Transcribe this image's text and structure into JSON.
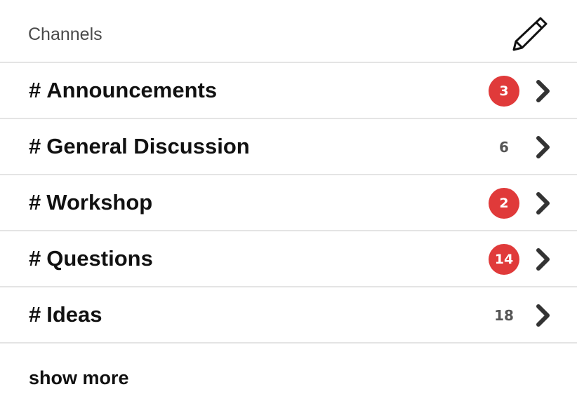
{
  "header": {
    "title": "Channels",
    "edit_icon": "pencil-icon"
  },
  "channels": [
    {
      "hash": "#",
      "name": "Announcements",
      "count": "3",
      "badge": true
    },
    {
      "hash": "#",
      "name": "General Discussion",
      "count": "6",
      "badge": false
    },
    {
      "hash": "#",
      "name": "Workshop",
      "count": "2",
      "badge": true
    },
    {
      "hash": "#",
      "name": "Questions",
      "count": "14",
      "badge": true
    },
    {
      "hash": "#",
      "name": "Ideas",
      "count": "18",
      "badge": false
    }
  ],
  "footer": {
    "show_more_label": "show more"
  },
  "colors": {
    "badge_red": "#e03a3a",
    "divider": "#e4e4e4",
    "muted_count": "#555555"
  }
}
